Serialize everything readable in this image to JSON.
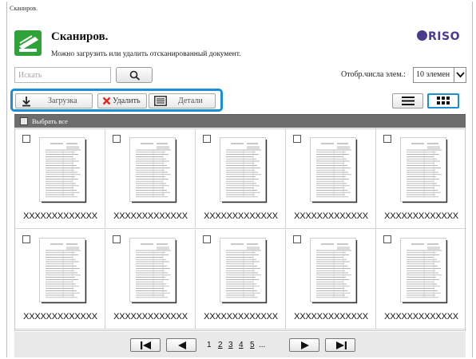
{
  "breadcrumb": "Сканиров.",
  "header": {
    "title": "Сканиров.",
    "subtitle": "Можно загрузить или удалить отсканированный документ.",
    "logo_text": "RISO",
    "app_icon": "scanner-icon",
    "brand_color": "#2fa23a",
    "logo_color": "#4b3a8c"
  },
  "search": {
    "placeholder": "Искать",
    "value": "",
    "button_icon": "search-icon"
  },
  "per_page": {
    "label": "Отобр.числа элем.:",
    "selected": "10 элемен"
  },
  "toolbar": {
    "upload_label": "Загрузка",
    "delete_label": "Удалить",
    "details_label": "Детали",
    "highlight_color": "#1c8fd4"
  },
  "view_modes": {
    "list_icon": "list-view-icon",
    "grid_icon": "grid-view-icon",
    "active": "grid"
  },
  "select_all_label": "Выбрать все",
  "items": [
    {
      "name": "XXXXXXXXXXXXX",
      "checked": false
    },
    {
      "name": "XXXXXXXXXXXXX",
      "checked": false
    },
    {
      "name": "XXXXXXXXXXXXX",
      "checked": false
    },
    {
      "name": "XXXXXXXXXXXXX",
      "checked": false
    },
    {
      "name": "XXXXXXXXXXXXX",
      "checked": false
    },
    {
      "name": "XXXXXXXXXXXXX",
      "checked": false
    },
    {
      "name": "XXXXXXXXXXXXX",
      "checked": false
    },
    {
      "name": "XXXXXXXXXXXXX",
      "checked": false
    },
    {
      "name": "XXXXXXXXXXXXX",
      "checked": false
    },
    {
      "name": "XXXXXXXXXXXXX",
      "checked": false
    }
  ],
  "pagination": {
    "pages": [
      "1",
      "2",
      "3",
      "4",
      "5"
    ],
    "current": "1",
    "ellipsis": "..."
  }
}
